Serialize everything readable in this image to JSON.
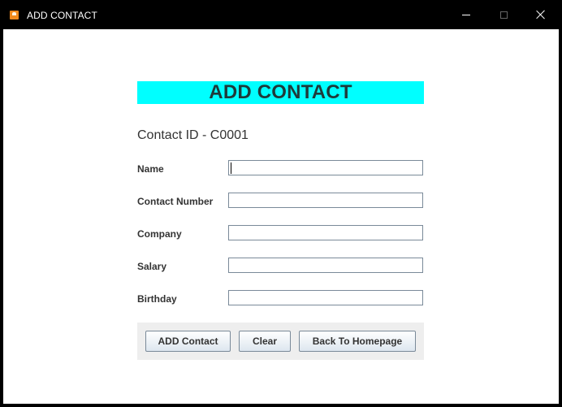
{
  "window": {
    "title": "ADD CONTACT",
    "app_icon": "contact-app-icon"
  },
  "form": {
    "heading": "ADD CONTACT",
    "heading_bg": "#00ffff",
    "contact_id": "Contact ID - C0001",
    "fields": [
      {
        "label": "Name",
        "value": ""
      },
      {
        "label": "Contact Number",
        "value": ""
      },
      {
        "label": "Company",
        "value": ""
      },
      {
        "label": "Salary",
        "value": ""
      },
      {
        "label": "Birthday",
        "value": ""
      }
    ]
  },
  "buttons": {
    "add": "ADD Contact",
    "clear": "Clear",
    "back": "Back To Homepage"
  }
}
